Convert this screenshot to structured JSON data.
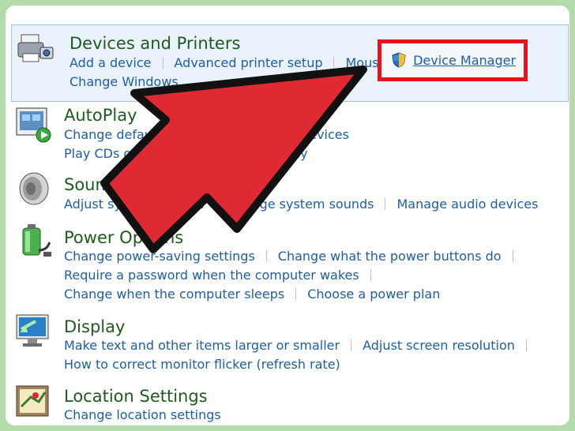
{
  "sections": [
    {
      "icon": "printer-camera-icon",
      "title": "Devices and Printers",
      "rows": [
        [
          "Add a device",
          "Advanced printer setup",
          "Mouse"
        ],
        [
          "Change Windows"
        ]
      ],
      "highlight_link": "Device Manager",
      "highlight_icon": "uac-shield-icon"
    },
    {
      "icon": "autoplay-icon",
      "title": "AutoPlay",
      "rows": [
        [
          "Change default settings for media or devices"
        ],
        [
          "Play CDs or other media automatically"
        ]
      ]
    },
    {
      "icon": "speaker-icon",
      "title": "Sound",
      "rows": [
        [
          "Adjust system volume",
          "Change system sounds",
          "Manage audio devices"
        ]
      ]
    },
    {
      "icon": "battery-plug-icon",
      "title": "Power Options",
      "rows": [
        [
          "Change power-saving settings",
          "Change what the power buttons do"
        ],
        [
          "Require a password when the computer wakes"
        ],
        [
          "Change when the computer sleeps",
          "Choose a power plan"
        ]
      ]
    },
    {
      "icon": "monitor-icon",
      "title": "Display",
      "rows": [
        [
          "Make text and other items larger or smaller",
          "Adjust screen resolution"
        ],
        [
          "How to correct monitor flicker (refresh rate)"
        ]
      ]
    },
    {
      "icon": "location-map-icon",
      "title": "Location Settings",
      "rows": [
        [
          "Change location settings"
        ]
      ]
    }
  ],
  "colors": {
    "title": "#1e5b1e",
    "link": "#1d5ea8",
    "highlight_border": "#e8121b",
    "arrow_fill": "#e02a33",
    "arrow_outline": "#111111",
    "background": "#b4dcab"
  }
}
